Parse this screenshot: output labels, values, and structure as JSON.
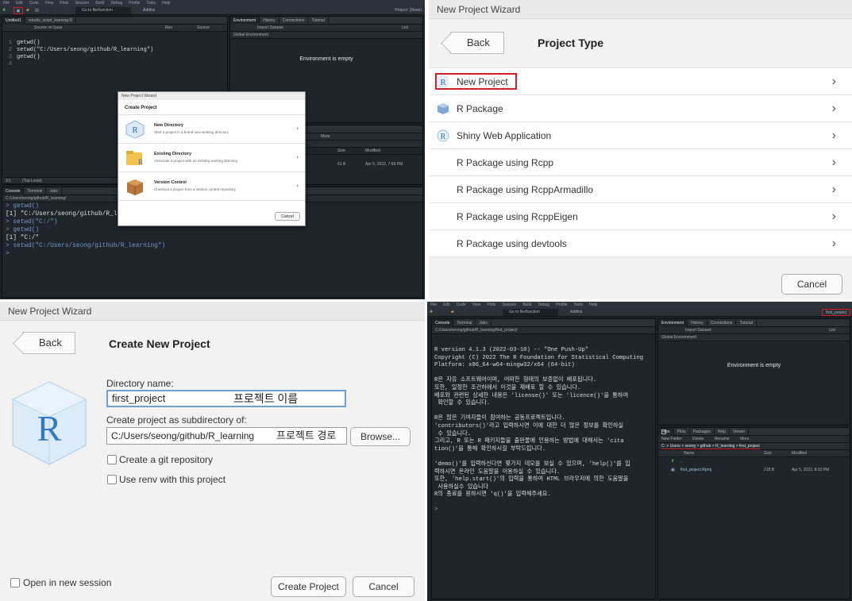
{
  "q1": {
    "menu": [
      "File",
      "Edit",
      "Code",
      "View",
      "Plots",
      "Session",
      "Build",
      "Debug",
      "Profile",
      "Tools",
      "Help"
    ],
    "toolbar": {
      "goto": "Go to file/function",
      "addins": "Addins",
      "project": "Project: (None)"
    },
    "editor": {
      "tabs": [
        "Untitled1",
        "rstudio_script_learning.R"
      ],
      "source_on_save": "Source on Save",
      "run": "Run",
      "source": "Source",
      "lines": [
        "getwd()",
        "setwd(\"C:/Users/seong/github/R_learning\")",
        "getwd()",
        ""
      ],
      "status": [
        "3:1",
        "(Top Level)"
      ]
    },
    "env": {
      "tabs": [
        "Environment",
        "History",
        "Connections",
        "Tutorial"
      ],
      "import": "Import Dataset",
      "list": "List",
      "global": "Global Environment",
      "empty": "Environment is empty"
    },
    "files": {
      "more": "More",
      "size": "Size",
      "modified": "Modified",
      "row_size": "61 B",
      "row_mod": "Apr 5, 2022, 7:59 PM"
    },
    "console": {
      "tabs": [
        "Console",
        "Terminal",
        "Jobs"
      ],
      "path": "C:/Users/seong/github/R_learning/",
      "lines": [
        "> getwd()",
        "[1] \"C:/Users/seong/github/R_learn",
        "> setwd(\"C:/\")",
        "> getwd()",
        "[1] \"C:/\"",
        "> setwd(\"C:/Users/seong/github/R_learning\")",
        "> "
      ]
    },
    "wizard": {
      "title": "New Project Wizard",
      "heading": "Create Project",
      "options": [
        {
          "title": "New Directory",
          "desc": "Start a project in a brand new working directory"
        },
        {
          "title": "Existing Directory",
          "desc": "Associate a project with an existing working directory"
        },
        {
          "title": "Version Control",
          "desc": "Checkout a project from a version control repository"
        }
      ],
      "cancel": "Cancel"
    }
  },
  "q2": {
    "window_title": "New Project Wizard",
    "back": "Back",
    "heading": "Project Type",
    "items": [
      "New Project",
      "R Package",
      "Shiny Web Application",
      "R Package using Rcpp",
      "R Package using RcppArmadillo",
      "R Package using RcppEigen",
      "R Package using devtools"
    ],
    "cancel": "Cancel",
    "highlight_color": "#d01f25"
  },
  "q3": {
    "window_title": "New Project Wizard",
    "back": "Back",
    "heading": "Create New Project",
    "dir_label": "Directory name:",
    "dir_value": "first_project",
    "dir_note": "프로젝트 이름",
    "sub_label": "Create project as subdirectory of:",
    "sub_value": "C:/Users/seong/github/R_learning",
    "sub_note": "프로젝트 경로",
    "browse": "Browse...",
    "git": "Create a git repository",
    "renv": "Use renv with this project",
    "new_session": "Open in new session",
    "create": "Create Project",
    "cancel": "Cancel"
  },
  "q4": {
    "menu": [
      "File",
      "Edit",
      "Code",
      "View",
      "Plots",
      "Session",
      "Build",
      "Debug",
      "Profile",
      "Tools",
      "Help"
    ],
    "toolbar": {
      "goto": "Go to file/function",
      "addins": "Addins",
      "project": "first_project"
    },
    "console": {
      "tabs": [
        "Console",
        "Terminal",
        "Jobs"
      ],
      "path": "C:/Users/seong/github/R_learning/first_project/",
      "lines": [
        "R version 4.1.3 (2022-03-10) -- \"One Push-Up\"",
        "Copyright (C) 2022 The R Foundation for Statistical Computing",
        "Platform: x86_64-w64-mingw32/x64 (64-bit)",
        "",
        "R은 자유 소프트웨어이며, 어떠한 형태의 보증없이 배포됩니다.",
        "또한, 일정한 조건하에서 이것을 재배포 할 수 있습니다.",
        "배포와 관련된 상세한 내용은 'license()' 또는 'licence()'을 통하여",
        " 확인할 수 있습니다.",
        "",
        "R은 많은 기여자들이 참여하는 공동프로젝트입니다.",
        "'contributors()'라고 입력하시면 이에 대한 더 많은 정보를 확인하실",
        " 수 있습니다.",
        "그리고, R 또는 R 패키지들을 출판물에 인용하는 방법에 대해서는 'cita",
        "tion()'을 통해 확인하시길 부탁드립니다.",
        "",
        "'demo()'를 입력하신다면 몇가지 데모를 보실 수 있으며, 'help()'를 입",
        "력하시면 온라인 도움말을 이용하실 수 있습니다.",
        "또한, 'help.start()'의 입력을 통하여 HTML 브라우저에 의한 도움말을",
        " 사용하실수 있습니다",
        "R의 종료를 원하시면 'q()'을 입력해주세요.",
        "",
        ">"
      ]
    },
    "env": {
      "tabs": [
        "Environment",
        "History",
        "Connections",
        "Tutorial"
      ],
      "import": "Import Dataset",
      "list": "List",
      "global": "Global Environment",
      "empty": "Environment is empty"
    },
    "files": {
      "tabs": [
        "Files",
        "Plots",
        "Packages",
        "Help",
        "Viewer"
      ],
      "new_folder": "New Folder",
      "delete": "Delete",
      "rename": "Rename",
      "more": "More",
      "breadcrumb": "C: > Users > seong > github > R_learning > first_project",
      "col_name": "Name",
      "col_size": "Size",
      "col_mod": "Modified",
      "rows": [
        {
          "name": "..",
          "size": "",
          "mod": ""
        },
        {
          "name": "first_project.Rproj",
          "size": "218 B",
          "mod": "Apr 5, 2022, 8:02 PM"
        }
      ]
    }
  }
}
